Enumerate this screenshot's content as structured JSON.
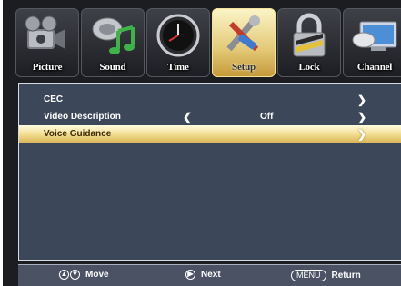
{
  "tabs": [
    {
      "label": "Picture",
      "icon": "camera-icon",
      "active": false
    },
    {
      "label": "Sound",
      "icon": "music-note-icon",
      "active": false
    },
    {
      "label": "Time",
      "icon": "clock-icon",
      "active": false
    },
    {
      "label": "Setup",
      "icon": "tools-icon",
      "active": true
    },
    {
      "label": "Lock",
      "icon": "padlock-icon",
      "active": false
    },
    {
      "label": "Channel",
      "icon": "satellite-dish-icon",
      "active": false
    }
  ],
  "menu": {
    "items": [
      {
        "label": "CEC",
        "value": "",
        "has_left_arrow": false,
        "has_right_arrow": true,
        "selected": false
      },
      {
        "label": "Video Description",
        "value": "Off",
        "has_left_arrow": true,
        "has_right_arrow": true,
        "selected": false
      },
      {
        "label": "Voice Guidance",
        "value": "",
        "has_left_arrow": false,
        "has_right_arrow": true,
        "selected": true
      }
    ],
    "left_arrow": "❮",
    "right_arrow": "❯"
  },
  "footer": {
    "move_label": "Move",
    "next_label": "Next",
    "menu_key": "MENU",
    "return_label": "Return"
  },
  "colors": {
    "panel_bg": "#3d475a",
    "highlight": "#f2dc8e",
    "footer_bg": "#4a5264"
  }
}
